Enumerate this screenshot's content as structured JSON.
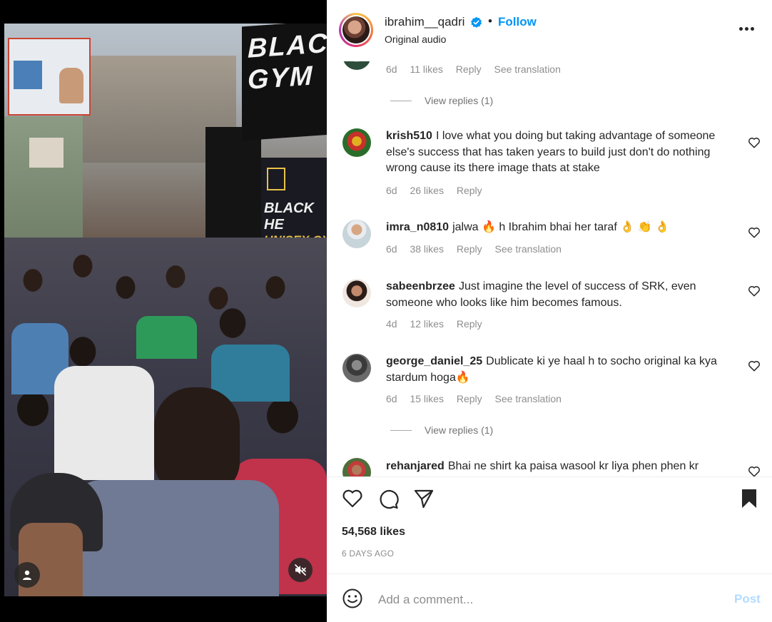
{
  "post": {
    "username": "ibrahim__qadri",
    "dot": "•",
    "follow_label": "Follow",
    "audio": "Original audio",
    "verified_icon": "verified-badge-icon",
    "colors": {
      "accent": "#0095f6",
      "post_disabled": "#b3dbff",
      "muted": "#8e8e8e"
    }
  },
  "video": {
    "banner_text": "BLACK\nGYM",
    "banner2_line1": "BLACK HE",
    "banner2_line2": "UNISEX GY"
  },
  "comments": [
    {
      "partial": true,
      "time": "6d",
      "likes": "11 likes",
      "reply": "Reply",
      "translate": "See translation"
    },
    {
      "view_replies": "View replies (1)"
    },
    {
      "user": "krish510",
      "text": "I love what you doing but taking advantage of someone else's success that has taken years to build just don't do nothing wrong cause its there image thats at stake",
      "time": "6d",
      "likes": "26 likes",
      "reply": "Reply"
    },
    {
      "user": "imra_n0810",
      "text": "jalwa 🔥 h Ibrahim bhai her taraf 👌 👏 👌",
      "time": "6d",
      "likes": "38 likes",
      "reply": "Reply",
      "translate": "See translation"
    },
    {
      "user": "sabeenbrzee",
      "text": "Just imagine the level of success of SRK, even someone who looks like him becomes famous.",
      "time": "4d",
      "likes": "12 likes",
      "reply": "Reply"
    },
    {
      "user": "george_daniel_25",
      "text": "Dublicate ki ye haal h to socho original ka kya stardum hoga🔥",
      "time": "6d",
      "likes": "15 likes",
      "reply": "Reply",
      "translate": "See translation"
    },
    {
      "view_replies": "View replies (1)"
    },
    {
      "user": "rehanjared",
      "text": "Bhai ne shirt ka paisa wasool kr liya phen phen kr"
    }
  ],
  "actions": {
    "likes": "54,568 likes",
    "time_ago": "6 DAYS AGO",
    "icons": [
      "heart-icon",
      "comment-icon",
      "share-icon",
      "bookmark-icon"
    ]
  },
  "composer": {
    "placeholder": "Add a comment...",
    "post_label": "Post"
  }
}
